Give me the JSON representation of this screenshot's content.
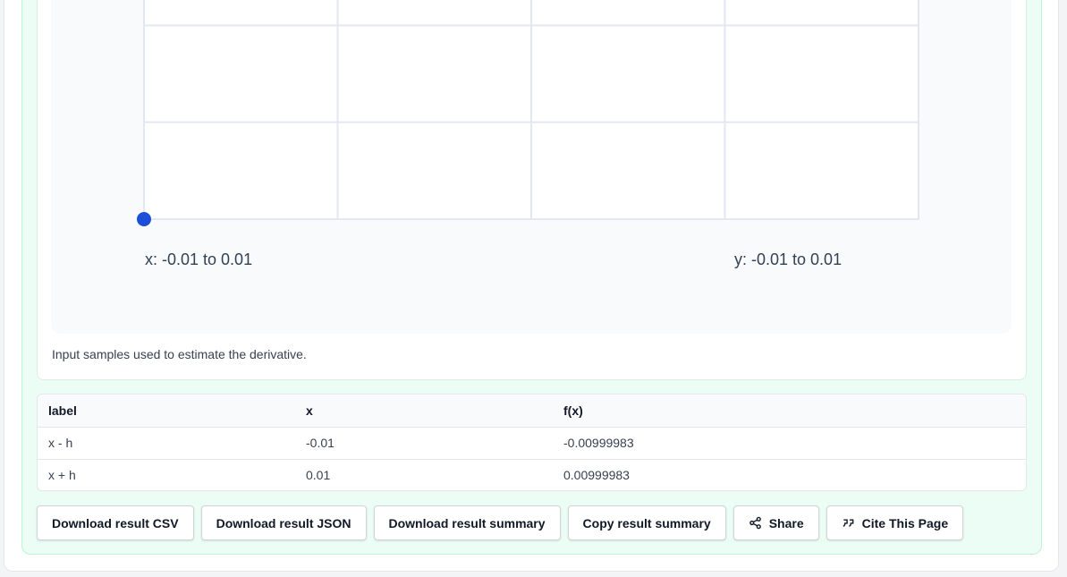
{
  "chart": {
    "x_range_text": "x: -0.01 to 0.01",
    "y_range_text": "y: -0.01 to 0.01",
    "caption": "Input samples used to estimate the derivative.",
    "point_color": "#1d4ed8",
    "grid_color": "#e2e8f0"
  },
  "chart_data": {
    "type": "scatter",
    "xlim": [
      -0.01,
      0.01
    ],
    "ylim": [
      -0.01,
      0.01
    ],
    "grid": true,
    "points": [
      {
        "x": -0.01,
        "y": -0.01
      }
    ]
  },
  "table": {
    "headers": [
      "label",
      "x",
      "f(x)"
    ],
    "rows": [
      [
        "x - h",
        "-0.01",
        "-0.00999983"
      ],
      [
        "x + h",
        "0.01",
        "0.00999983"
      ]
    ]
  },
  "actions": {
    "download_csv": "Download result CSV",
    "download_json": "Download result JSON",
    "download_summary": "Download result summary",
    "copy_summary": "Copy result summary",
    "share": "Share",
    "cite": "Cite This Page"
  },
  "icons": {
    "share": "share-icon",
    "cite": "quote-icon"
  }
}
